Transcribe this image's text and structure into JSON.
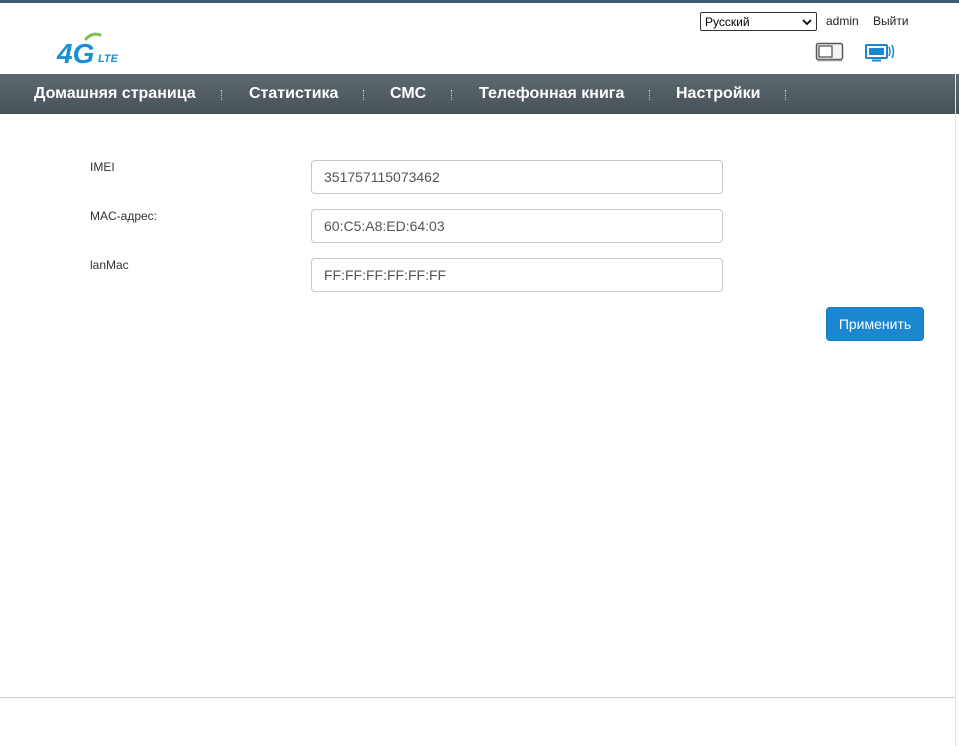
{
  "header": {
    "language": {
      "selected": "Русский"
    },
    "user": "admin",
    "logout_label": "Выйти",
    "icons": {
      "logo": "4g-lte-logo",
      "mobile_view": "mobile-view-icon",
      "desktop_view": "desktop-view-icon"
    },
    "logo_text": {
      "main": "4G",
      "sub": "LTE"
    }
  },
  "nav": {
    "items": [
      {
        "label": "Домашняя страница"
      },
      {
        "label": "Статистика"
      },
      {
        "label": "СМС"
      },
      {
        "label": "Телефонная книга"
      },
      {
        "label": "Настройки"
      }
    ]
  },
  "form": {
    "fields": [
      {
        "label": "IMEI",
        "value": "351757115073462"
      },
      {
        "label": "MAC-адрес:",
        "value": "60:C5:A8:ED:64:03"
      },
      {
        "label": "lanMac",
        "value": "FF:FF:FF:FF:FF:FF"
      }
    ],
    "apply_label": "Применить"
  },
  "colors": {
    "nav_bg": "#4f5b60",
    "accent": "#1a87d0",
    "logo_blue": "#1a8fd6",
    "logo_green": "#7dc242"
  }
}
